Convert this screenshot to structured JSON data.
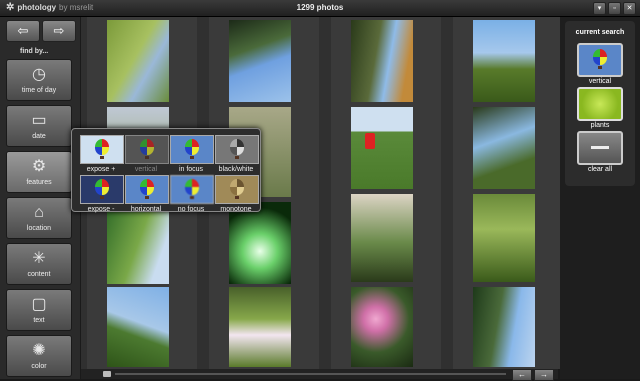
{
  "titlebar": {
    "app_name": "photology",
    "by": "by msrelit",
    "photo_count": "1299 photos"
  },
  "sidebar": {
    "find_by": "find by...",
    "buttons": [
      {
        "label": "time of day",
        "icon": "clock-icon"
      },
      {
        "label": "date",
        "icon": "calendar-icon"
      },
      {
        "label": "features",
        "icon": "gear-icon"
      },
      {
        "label": "location",
        "icon": "house-icon"
      },
      {
        "label": "content",
        "icon": "sparkle-icon"
      },
      {
        "label": "text",
        "icon": "speech-bubble-icon"
      },
      {
        "label": "color",
        "icon": "palette-icon"
      }
    ]
  },
  "features_popup": {
    "options": [
      {
        "label": "expose +"
      },
      {
        "label": "vertical"
      },
      {
        "label": "in focus"
      },
      {
        "label": "black/white"
      },
      {
        "label": "expose -"
      },
      {
        "label": "horizontal"
      },
      {
        "label": "no focus"
      },
      {
        "label": "monotone"
      }
    ]
  },
  "current_search": {
    "title": "current search",
    "items": [
      {
        "label": "vertical"
      },
      {
        "label": "plants"
      }
    ],
    "clear_label": "clear all"
  },
  "colors": {
    "accent_plants": "#9acd32",
    "background": "#1a1a1a"
  }
}
